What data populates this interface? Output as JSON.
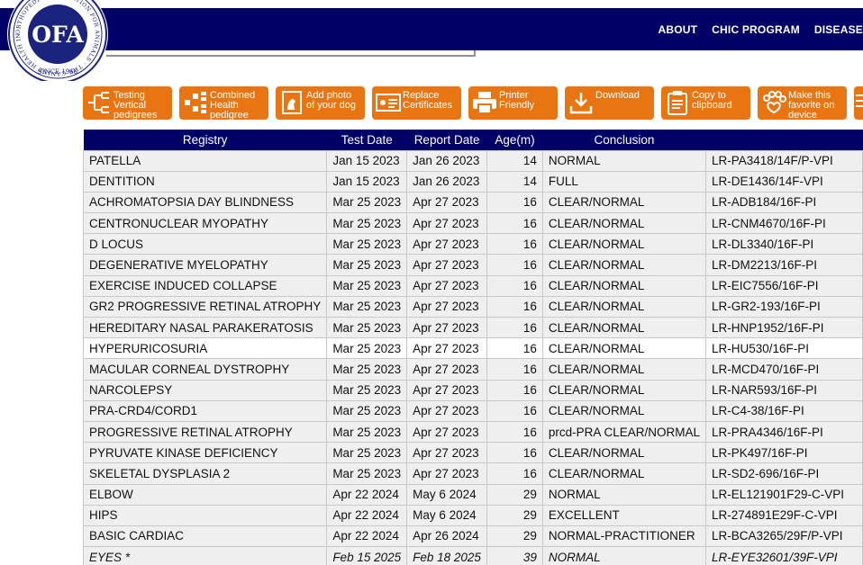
{
  "header": {
    "logo_text": "OFA",
    "logo_ring_text": "ORTHOPEDIC FOUNDATION FOR ANIMALS · THE CANINE HEALTH INFORMATION CENTER",
    "logo_since": "SINCE 1966",
    "nav": [
      "ABOUT",
      "CHIC PROGRAM",
      "DISEASE"
    ]
  },
  "toolbar": [
    {
      "icon": "pedigree-tree-icon",
      "label": "Testing\nVertical\npedigrees"
    },
    {
      "icon": "combined-pedigree-icon",
      "label": "Combined\nHealth\npedigree"
    },
    {
      "icon": "dog-photo-icon",
      "label": "Add photo\nof your dog"
    },
    {
      "icon": "certificate-icon",
      "label": "Replace\nCertificates"
    },
    {
      "icon": "printer-icon",
      "label": "Printer\nFriendly"
    },
    {
      "icon": "download-icon",
      "label": "Download"
    },
    {
      "icon": "clipboard-icon",
      "label": "Copy to\nclipboard"
    },
    {
      "icon": "paw-heart-icon",
      "label": "Make this\nfavorite on\ndevice"
    }
  ],
  "table": {
    "headers": [
      "Registry",
      "Test Date",
      "Report Date",
      "Age(m)",
      "Conclusion",
      ""
    ],
    "rows": [
      [
        "PATELLA",
        "Jan 15 2023",
        "Jan 26 2023",
        "14",
        "NORMAL",
        "LR-PA3418/14F/P-VPI"
      ],
      [
        "DENTITION",
        "Jan 15 2023",
        "Jan 26 2023",
        "14",
        "FULL",
        "LR-DE1436/14F-VPI"
      ],
      [
        "ACHROMATOPSIA DAY BLINDNESS",
        "Mar 25 2023",
        "Apr 27 2023",
        "16",
        "CLEAR/NORMAL",
        "LR-ADB184/16F-PI"
      ],
      [
        "CENTRONUCLEAR MYOPATHY",
        "Mar 25 2023",
        "Apr 27 2023",
        "16",
        "CLEAR/NORMAL",
        "LR-CNM4670/16F-PI"
      ],
      [
        "D LOCUS",
        "Mar 25 2023",
        "Apr 27 2023",
        "16",
        "CLEAR/NORMAL",
        "LR-DL3340/16F-PI"
      ],
      [
        "DEGENERATIVE MYELOPATHY",
        "Mar 25 2023",
        "Apr 27 2023",
        "16",
        "CLEAR/NORMAL",
        "LR-DM2213/16F-PI"
      ],
      [
        "EXERCISE INDUCED COLLAPSE",
        "Mar 25 2023",
        "Apr 27 2023",
        "16",
        "CLEAR/NORMAL",
        "LR-EIC7556/16F-PI"
      ],
      [
        "GR2 PROGRESSIVE RETINAL ATROPHY",
        "Mar 25 2023",
        "Apr 27 2023",
        "16",
        "CLEAR/NORMAL",
        "LR-GR2-193/16F-PI"
      ],
      [
        "HEREDITARY NASAL PARAKERATOSIS",
        "Mar 25 2023",
        "Apr 27 2023",
        "16",
        "CLEAR/NORMAL",
        "LR-HNP1952/16F-PI"
      ],
      [
        "HYPERURICOSURIA",
        "Mar 25 2023",
        "Apr 27 2023",
        "16",
        "CLEAR/NORMAL",
        "LR-HU530/16F-PI"
      ],
      [
        "MACULAR CORNEAL DYSTROPHY",
        "Mar 25 2023",
        "Apr 27 2023",
        "16",
        "CLEAR/NORMAL",
        "LR-MCD470/16F-PI"
      ],
      [
        "NARCOLEPSY",
        "Mar 25 2023",
        "Apr 27 2023",
        "16",
        "CLEAR/NORMAL",
        "LR-NAR593/16F-PI"
      ],
      [
        "PRA-CRD4/CORD1",
        "Mar 25 2023",
        "Apr 27 2023",
        "16",
        "CLEAR/NORMAL",
        "LR-C4-38/16F-PI"
      ],
      [
        "PROGRESSIVE RETINAL ATROPHY",
        "Mar 25 2023",
        "Apr 27 2023",
        "16",
        "prcd-PRA CLEAR/NORMAL",
        "LR-PRA4346/16F-PI"
      ],
      [
        "PYRUVATE KINASE DEFICIENCY",
        "Mar 25 2023",
        "Apr 27 2023",
        "16",
        "CLEAR/NORMAL",
        "LR-PK497/16F-PI"
      ],
      [
        "SKELETAL DYSPLASIA 2",
        "Mar 25 2023",
        "Apr 27 2023",
        "16",
        "CLEAR/NORMAL",
        "LR-SD2-696/16F-PI"
      ],
      [
        "ELBOW",
        "Apr 22 2024",
        "May 6 2024",
        "29",
        "NORMAL",
        "LR-EL121901F29-C-VPI"
      ],
      [
        "HIPS",
        "Apr 22 2024",
        "May 6 2024",
        "29",
        "EXCELLENT",
        "LR-274891E29F-C-VPI"
      ],
      [
        "BASIC CARDIAC",
        "Apr 22 2024",
        "Apr 26 2024",
        "29",
        "NORMAL-PRACTITIONER",
        "LR-BCA3265/29F/P-VPI"
      ],
      [
        "EYES *",
        "Feb 15 2025",
        "Feb 18 2025",
        "39",
        "NORMAL",
        "LR-EYE32601/39F-VPI"
      ]
    ],
    "highlight_row": 9,
    "italic_row": 19
  },
  "colors": {
    "navy": "#000066",
    "orange": "#e87511",
    "row": "#efefef"
  }
}
